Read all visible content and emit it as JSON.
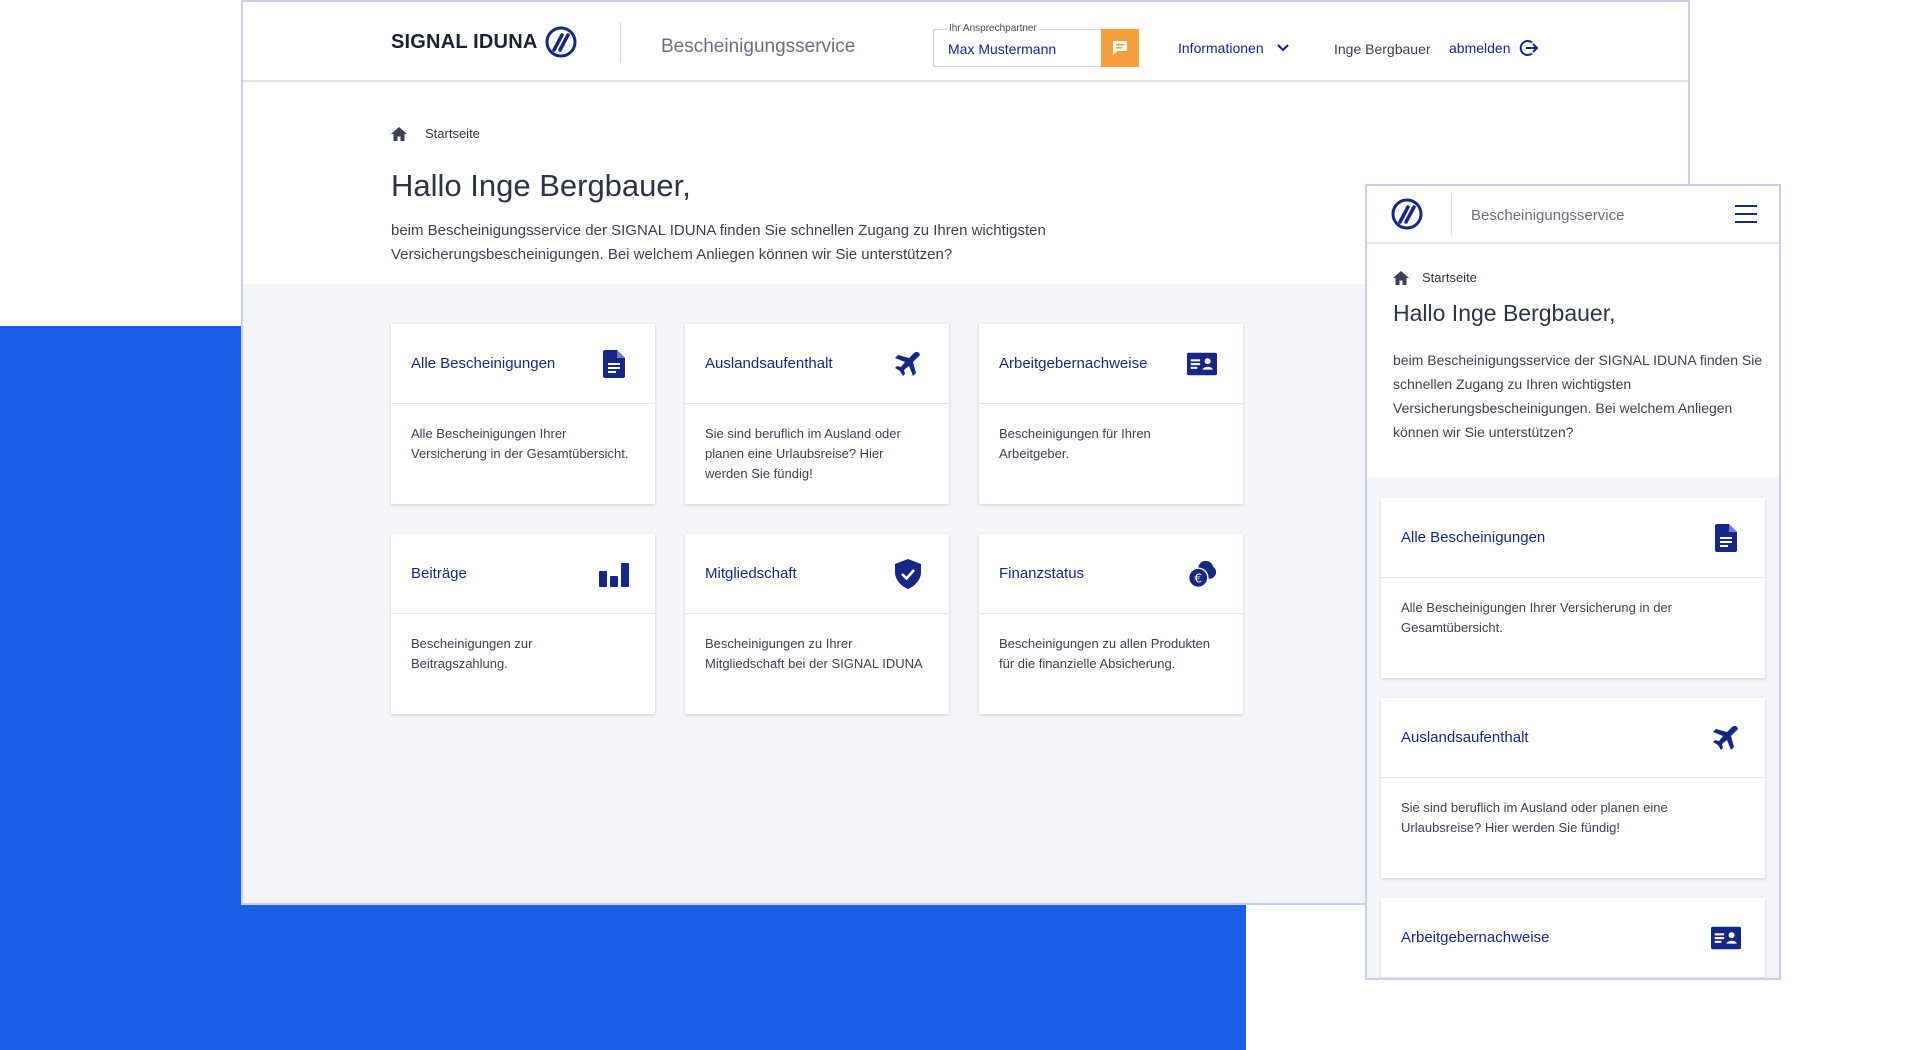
{
  "colors": {
    "brand_blue": "#15288a",
    "accent_blue": "#1a5de6",
    "orange": "#f5a03a"
  },
  "header": {
    "logo_text": "SIGNAL IDUNA",
    "service_title": "Bescheinigungsservice",
    "contact_label": "Ihr Ansprechpartner",
    "contact_name": "Max Mustermann",
    "info_link": "Informationen",
    "user_name": "Inge Bergbauer",
    "logout": "abmelden"
  },
  "breadcrumb": {
    "home": "Startseite"
  },
  "greeting": "Hallo Inge Bergbauer,",
  "intro": "beim Bescheinigungsservice der SIGNAL IDUNA finden Sie schnellen Zugang zu Ihren wichtigsten Versicherungsbescheinigungen. Bei welchem Anliegen können wir Sie unterstützen?",
  "cards": [
    {
      "title": "Alle Bescheinigungen",
      "icon": "document-icon",
      "desc": "Alle Bescheinigungen Ihrer Versicherung in der Gesamtübersicht."
    },
    {
      "title": "Auslandsaufenthalt",
      "icon": "airplane-icon",
      "desc": "Sie sind beruflich im Ausland oder planen eine Urlaubsreise? Hier werden Sie fündig!"
    },
    {
      "title": "Arbeitgebernachweise",
      "icon": "id-card-icon",
      "desc": "Bescheinigungen für Ihren Arbeitgeber."
    },
    {
      "title": "Beiträge",
      "icon": "bar-chart-icon",
      "desc": "Bescheinigungen zur Beitragszahlung."
    },
    {
      "title": "Mitgliedschaft",
      "icon": "shield-check-icon",
      "desc": "Bescheinigungen zu Ihrer Mitgliedschaft bei der SIGNAL IDUNA"
    },
    {
      "title": "Finanzstatus",
      "icon": "euro-coins-icon",
      "desc": "Bescheinigungen zu allen Produkten für die finanzielle Absicherung."
    }
  ],
  "mobile": {
    "service_title": "Bescheinigungsservice",
    "home": "Startseite",
    "greeting": "Hallo Inge Bergbauer,",
    "intro": "beim Bescheinigungsservice der SIGNAL IDUNA finden Sie schnellen Zugang zu Ihren wichtigsten Versicherungsbescheinigungen. Bei welchem Anliegen können wir Sie unterstützen?",
    "cards": [
      {
        "title": "Alle Bescheinigungen",
        "desc": "Alle Bescheinigungen Ihrer Versicherung in der Gesamtübersicht."
      },
      {
        "title": "Auslandsaufenthalt",
        "desc": "Sie sind beruflich im Ausland oder planen eine Urlaubsreise? Hier werden Sie fündig!"
      },
      {
        "title": "Arbeitgebernachweise",
        "desc": ""
      }
    ]
  }
}
